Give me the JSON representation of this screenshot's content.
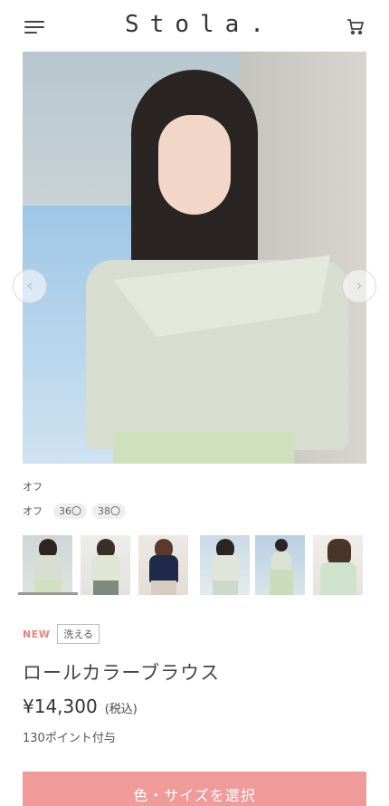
{
  "header": {
    "logo": "Stola.",
    "menu_icon": "hamburger-menu-icon",
    "cart_icon": "cart-icon"
  },
  "gallery": {
    "prev_icon": "‹",
    "next_icon": "›"
  },
  "variant": {
    "color_label": "オフ",
    "color_name": "オフ",
    "sizes": [
      "36〇",
      "38〇"
    ]
  },
  "badges": {
    "new": "NEW",
    "washable": "洗える"
  },
  "product": {
    "title": "ロールカラーブラウス",
    "price": "¥14,300",
    "tax_note": "(税込)",
    "points": "130ポイント付与"
  },
  "actions": {
    "select_label": "色・サイズを選択"
  },
  "colors": {
    "accent": "#f19a9a",
    "new_badge": "#e8827d"
  }
}
